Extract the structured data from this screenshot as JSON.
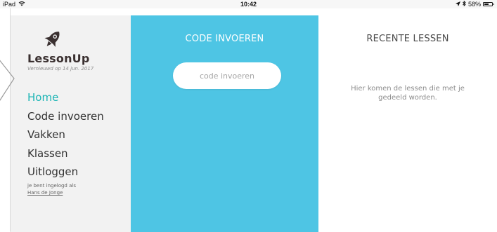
{
  "status_bar": {
    "device": "iPad",
    "time": "10:42",
    "battery_percent": "58%",
    "battery_level": 0.58,
    "icons": [
      "wifi-icon",
      "location-arrow-icon",
      "bluetooth-icon",
      "battery-icon"
    ]
  },
  "sidebar": {
    "brand_name": "LessonUp",
    "updated": "Vernieuwd op 14 jun. 2017",
    "logo_icon": "rocket-icon",
    "nav": [
      {
        "label": "Home",
        "active": true
      },
      {
        "label": "Code invoeren",
        "active": false
      },
      {
        "label": "Vakken",
        "active": false
      },
      {
        "label": "Klassen",
        "active": false
      },
      {
        "label": "Uitloggen",
        "active": false
      }
    ],
    "login_text": "je bent ingelogd als",
    "user_name": "Hans de Jonge"
  },
  "code_panel": {
    "title": "CODE INVOEREN",
    "input_placeholder": "code invoeren",
    "input_value": ""
  },
  "recent_panel": {
    "title": "RECENTE LESSEN",
    "empty_message": "Hier komen de lessen die met je gedeeld worden."
  },
  "colors": {
    "accent_teal": "#1cb5b5",
    "code_panel_blue": "#4ec5e4",
    "sidebar_bg": "#f2f2f2",
    "brand_dark": "#3a3030"
  }
}
